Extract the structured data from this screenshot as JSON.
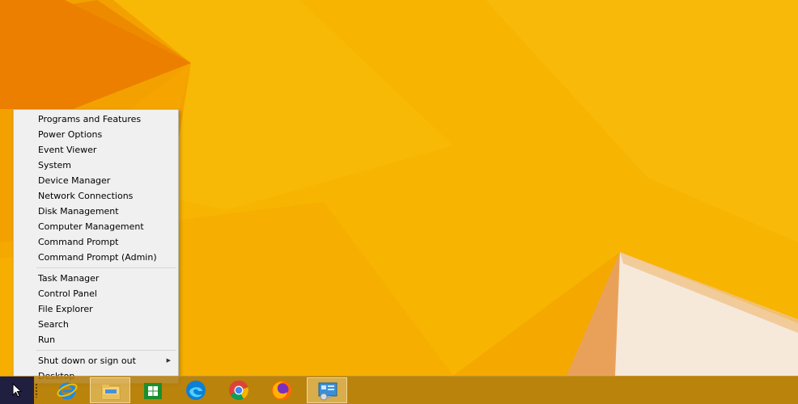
{
  "menu": {
    "groups": [
      [
        {
          "label": "Programs and Features"
        },
        {
          "label": "Power Options"
        },
        {
          "label": "Event Viewer"
        },
        {
          "label": "System"
        },
        {
          "label": "Device Manager"
        },
        {
          "label": "Network Connections"
        },
        {
          "label": "Disk Management"
        },
        {
          "label": "Computer Management"
        },
        {
          "label": "Command Prompt"
        },
        {
          "label": "Command Prompt (Admin)"
        }
      ],
      [
        {
          "label": "Task Manager"
        },
        {
          "label": "Control Panel"
        },
        {
          "label": "File Explorer"
        },
        {
          "label": "Search"
        },
        {
          "label": "Run"
        }
      ],
      [
        {
          "label": "Shut down or sign out",
          "submenu": true
        },
        {
          "label": "Desktop"
        }
      ]
    ]
  },
  "taskbar": {
    "start_icon": "start-button-icon",
    "apps": [
      {
        "name": "internet-explorer",
        "icon": "internet-explorer-icon",
        "active": false
      },
      {
        "name": "file-explorer",
        "icon": "file-explorer-icon",
        "active": true
      },
      {
        "name": "windows-store",
        "icon": "windows-store-icon",
        "active": false
      },
      {
        "name": "microsoft-edge",
        "icon": "edge-icon",
        "active": false
      },
      {
        "name": "google-chrome",
        "icon": "chrome-icon",
        "active": false
      },
      {
        "name": "firefox",
        "icon": "firefox-icon",
        "active": false
      },
      {
        "name": "control-panel",
        "icon": "control-panel-icon",
        "active": true
      }
    ]
  },
  "colors": {
    "wallpaper_base": "#f7b500",
    "wallpaper_orange": "#f08c00",
    "taskbar": "#b27c0e",
    "start_button": "#211f3f",
    "menu_background": "#f0f0f0"
  }
}
